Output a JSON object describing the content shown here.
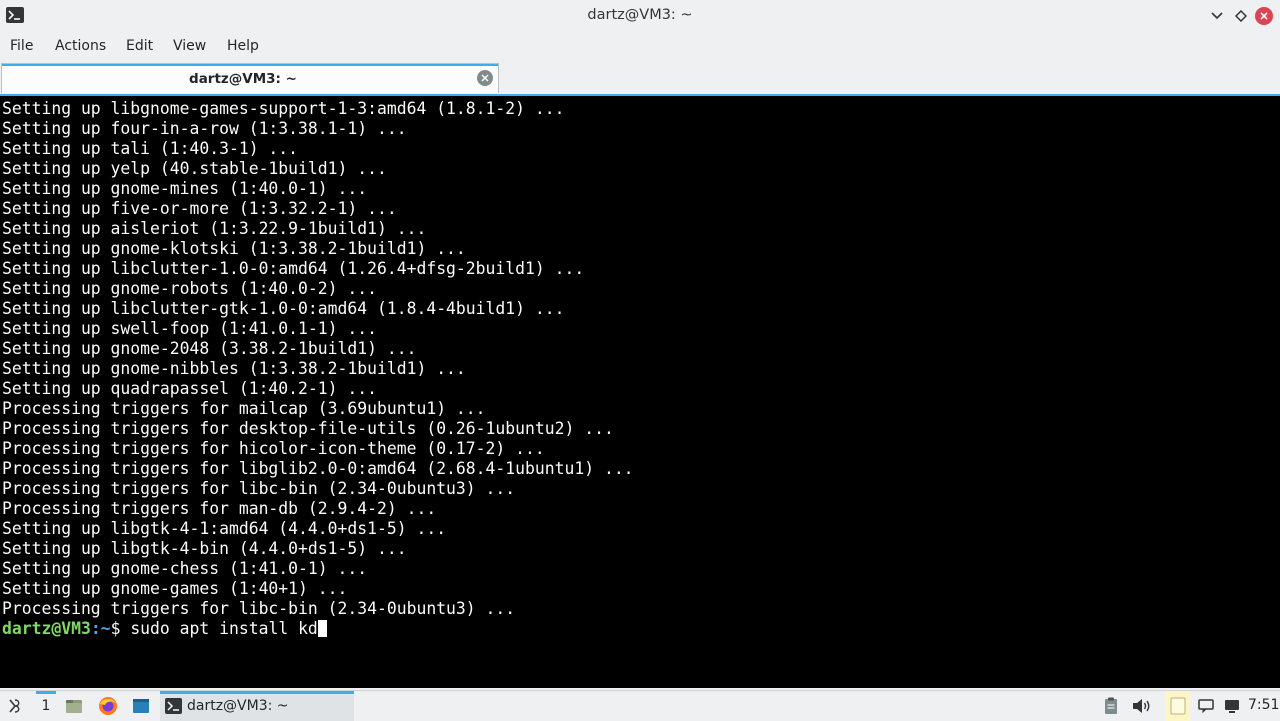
{
  "window": {
    "title": "dartz@VM3: ~"
  },
  "menu": {
    "items": [
      "File",
      "Actions",
      "Edit",
      "View",
      "Help"
    ]
  },
  "tab": {
    "label": "dartz@VM3: ~"
  },
  "terminal": {
    "lines": [
      "Setting up libgnome-games-support-1-3:amd64 (1.8.1-2) ...",
      "Setting up four-in-a-row (1:3.38.1-1) ...",
      "Setting up tali (1:40.3-1) ...",
      "Setting up yelp (40.stable-1build1) ...",
      "Setting up gnome-mines (1:40.0-1) ...",
      "Setting up five-or-more (1:3.32.2-1) ...",
      "Setting up aisleriot (1:3.22.9-1build1) ...",
      "Setting up gnome-klotski (1:3.38.2-1build1) ...",
      "Setting up libclutter-1.0-0:amd64 (1.26.4+dfsg-2build1) ...",
      "Setting up gnome-robots (1:40.0-2) ...",
      "Setting up libclutter-gtk-1.0-0:amd64 (1.8.4-4build1) ...",
      "Setting up swell-foop (1:41.0.1-1) ...",
      "Setting up gnome-2048 (3.38.2-1build1) ...",
      "Setting up gnome-nibbles (1:3.38.2-1build1) ...",
      "Setting up quadrapassel (1:40.2-1) ...",
      "Processing triggers for mailcap (3.69ubuntu1) ...",
      "Processing triggers for desktop-file-utils (0.26-1ubuntu2) ...",
      "Processing triggers for hicolor-icon-theme (0.17-2) ...",
      "Processing triggers for libglib2.0-0:amd64 (2.68.4-1ubuntu1) ...",
      "Processing triggers for libc-bin (2.34-0ubuntu3) ...",
      "Processing triggers for man-db (2.9.4-2) ...",
      "Setting up libgtk-4-1:amd64 (4.4.0+ds1-5) ...",
      "Setting up libgtk-4-bin (4.4.0+ds1-5) ...",
      "Setting up gnome-chess (1:41.0-1) ...",
      "Setting up gnome-games (1:40+1) ...",
      "Processing triggers for libc-bin (2.34-0ubuntu3) ..."
    ],
    "prompt_user": "dartz@VM3",
    "prompt_path": ":~",
    "prompt_symbol": "$ ",
    "command": "sudo apt install kd"
  },
  "taskbar": {
    "desktop_number": "1",
    "task_label": "dartz@VM3: ~",
    "clock": "7:51"
  },
  "colors": {
    "accent": "#3daee9",
    "prompt_user": "#7fd962",
    "prompt_path": "#5b9ee0",
    "close_button": "#da4453"
  }
}
